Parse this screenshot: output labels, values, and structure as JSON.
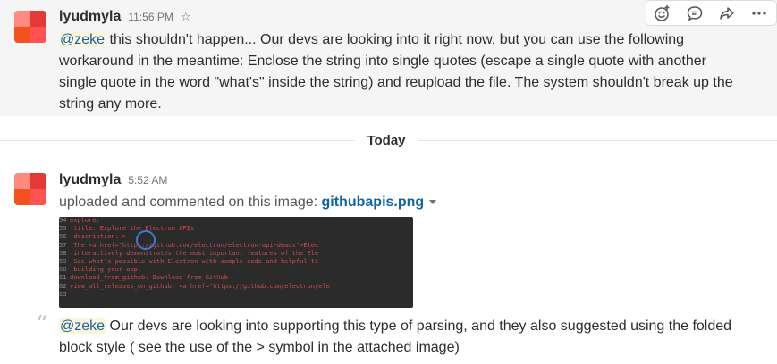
{
  "message1": {
    "author": "lyudmyla",
    "time": "11:56 PM",
    "mention": "@zeke",
    "text": " this shouldn't happen... Our devs are looking into it right now, but you can use the following workaround in the meantime: Enclose the string into single quotes (escape a single quote with another single quote in the word \"what's\" inside the string) and reupload the file. The system shouldn't break up the string any more."
  },
  "actions": {
    "icons": [
      "add-reaction-icon",
      "comment-icon",
      "share-icon",
      "more-actions-icon"
    ]
  },
  "divider": {
    "label": "Today"
  },
  "message2": {
    "author": "lyudmyla",
    "time": "5:52 AM",
    "upload_prefix": "uploaded and commented on this image: ",
    "filename": "githubapis.png",
    "comment_mention": "@zeke",
    "comment_text": " Our devs are looking into supporting this type of parsing, and they also suggested using the folded block style ( see the use of the > symbol in the attached image)"
  },
  "thumbnail": {
    "lines": [
      {
        "n": "54",
        "t": "explore:"
      },
      {
        "n": "55",
        "t": "  title: Explore the Electron APIs"
      },
      {
        "n": "56",
        "t": "  description: >"
      },
      {
        "n": "57",
        "t": "    The <a href=\"https://github.com/electron/electron-api-demos\">Elec"
      },
      {
        "n": "58",
        "t": "    interactively demonstrates the most important features of the Ele"
      },
      {
        "n": "59",
        "t": "    See what's possible with Electron with sample code and helpful ti"
      },
      {
        "n": "60",
        "t": "    building your app."
      },
      {
        "n": "61",
        "t": "download_from_github: Download from GitHub"
      },
      {
        "n": "62",
        "t": "view_all_releases_on_github: <a href=\"https://github.com/electron/ele"
      },
      {
        "n": "63",
        "t": ""
      }
    ],
    "accent_color": "#d44950"
  }
}
